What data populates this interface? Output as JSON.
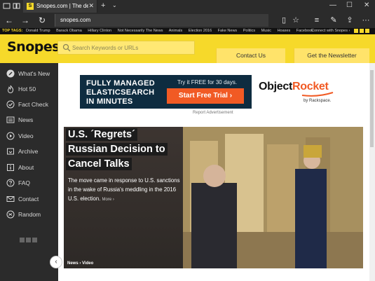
{
  "browser": {
    "tab_title": "Snopes.com | The defini",
    "favicon_letter": "S",
    "address": "snopes.com",
    "close_glyph": "✕",
    "new_tab_glyph": "+",
    "tab_dropdown_glyph": "⌄",
    "win_min": "—",
    "win_max": "☐",
    "win_close": "✕",
    "nav": {
      "back": "←",
      "forward": "→",
      "refresh": "↻"
    },
    "tools": {
      "reading": "▯",
      "favorite": "☆",
      "hub": "≡",
      "notes": "✎",
      "share": "⇪",
      "more": "···"
    }
  },
  "tagbar": {
    "label": "TOP TAGS:",
    "tags": [
      "Donald Trump",
      "Barack Obama",
      "Hillary Clinton",
      "Not Necessarily The News",
      "Animals",
      "Election 2016",
      "Fake News",
      "Politics",
      "Music",
      "Hoaxes",
      "Facebook"
    ],
    "connect": "Connect with Snopes ›"
  },
  "header": {
    "logo": "Snopes",
    "search_placeholder": "Search Keywords or URLs",
    "contact": "Contact Us",
    "newsletter": "Get the Newsletter"
  },
  "sidebar": {
    "items": [
      {
        "label": "What's New",
        "icon": "pencil-icon"
      },
      {
        "label": "Hot 50",
        "icon": "flame-icon"
      },
      {
        "label": "Fact Check",
        "icon": "check-icon"
      },
      {
        "label": "News",
        "icon": "news-icon"
      },
      {
        "label": "Video",
        "icon": "play-icon"
      },
      {
        "label": "Archive",
        "icon": "archive-icon"
      },
      {
        "label": "About",
        "icon": "info-icon"
      },
      {
        "label": "FAQ",
        "icon": "question-icon"
      },
      {
        "label": "Contact",
        "icon": "mail-icon"
      },
      {
        "label": "Random",
        "icon": "shuffle-icon"
      }
    ]
  },
  "ad": {
    "line1": "FULLY MANAGED",
    "line2": "ELASTICSEARCH",
    "line3": "IN MINUTES",
    "try_text": "Try it FREE for 30 days.",
    "cta": "Start Free Trial ›",
    "brand_a": "Object",
    "brand_b": "Rocket",
    "brand_sub": "by Rackspace.",
    "report": "Report Advertisement"
  },
  "hero": {
    "headline_lines": [
      "U.S. ´Regrets´",
      "Russian Decision to",
      "Cancel Talks"
    ],
    "description": "The move came in response to U.S. sanctions in the wake of Russia's meddling in the 2016 U.S. election.",
    "more": "More ›",
    "category": "News › Video",
    "collapse_glyph": "‹"
  },
  "colors": {
    "brand_yellow": "#f6d92a",
    "sidebar_bg": "#2b2b2b",
    "chrome_bg": "#2b2b2b",
    "ad_navy": "#0e2c40",
    "ad_orange": "#f15a24"
  }
}
